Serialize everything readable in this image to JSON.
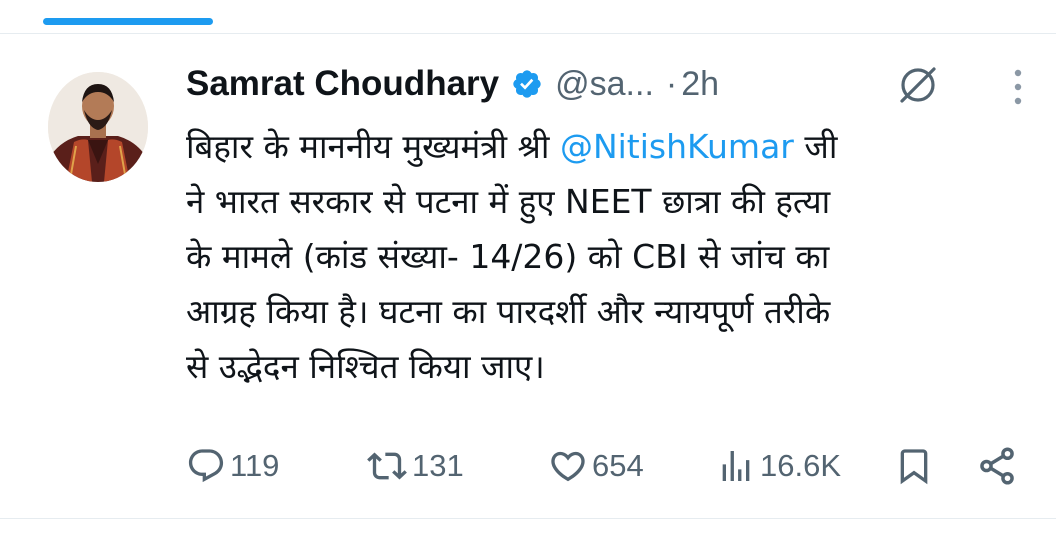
{
  "tweet": {
    "author_name": "Samrat Choudhary",
    "handle": "@sa...",
    "separator": "·",
    "time": "2h",
    "text": {
      "line1_pre": "बिहार के माननीय मुख्यमंत्री श्री ",
      "mention": "@NitishKumar",
      "line1_post": " जी",
      "line2": "ने भारत सरकार से पटना में हुए NEET छात्रा की हत्या",
      "line3": "के मामले (कांड संख्या- 14/26) को CBI से जांच का",
      "line4": "आग्रह किया है। घटना का पारदर्शी और न्यायपूर्ण तरीके",
      "line5": "से उद्भेदन निश्चित किया जाए।"
    },
    "actions": {
      "replies": "119",
      "reposts": "131",
      "likes": "654",
      "views": "16.6K"
    }
  },
  "icons": {
    "verified": "verified-badge-icon",
    "grok": "grok-icon",
    "more": "more-vertical-icon",
    "reply": "reply-icon",
    "repost": "repost-icon",
    "like": "heart-icon",
    "views": "views-icon",
    "bookmark": "bookmark-icon",
    "share": "share-icon"
  },
  "colors": {
    "accent": "#1d9bf0",
    "text": "#0f1419",
    "secondary": "#536471",
    "divider": "#e6ecf0"
  }
}
